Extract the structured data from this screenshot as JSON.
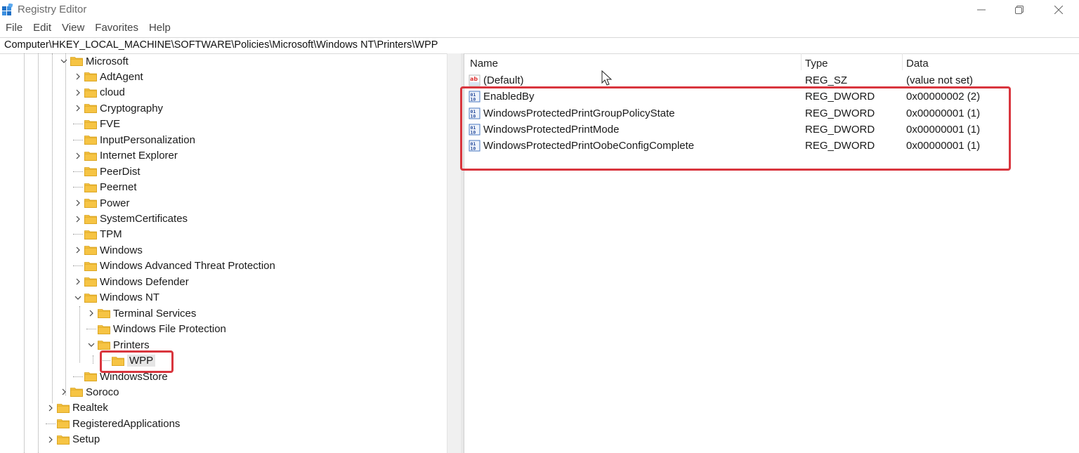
{
  "window": {
    "title": "Registry Editor"
  },
  "menu": {
    "items": [
      "File",
      "Edit",
      "View",
      "Favorites",
      "Help"
    ]
  },
  "address": "Computer\\HKEY_LOCAL_MACHINE\\SOFTWARE\\Policies\\Microsoft\\Windows NT\\Printers\\WPP",
  "tree": [
    {
      "label": "Microsoft",
      "depth": 0,
      "chevron": "down"
    },
    {
      "label": "AdtAgent",
      "depth": 1,
      "chevron": "right"
    },
    {
      "label": "cloud",
      "depth": 1,
      "chevron": "right"
    },
    {
      "label": "Cryptography",
      "depth": 1,
      "chevron": "right"
    },
    {
      "label": "FVE",
      "depth": 1,
      "chevron": "none"
    },
    {
      "label": "InputPersonalization",
      "depth": 1,
      "chevron": "none"
    },
    {
      "label": "Internet Explorer",
      "depth": 1,
      "chevron": "right"
    },
    {
      "label": "PeerDist",
      "depth": 1,
      "chevron": "none"
    },
    {
      "label": "Peernet",
      "depth": 1,
      "chevron": "none"
    },
    {
      "label": "Power",
      "depth": 1,
      "chevron": "right"
    },
    {
      "label": "SystemCertificates",
      "depth": 1,
      "chevron": "right"
    },
    {
      "label": "TPM",
      "depth": 1,
      "chevron": "none"
    },
    {
      "label": "Windows",
      "depth": 1,
      "chevron": "right"
    },
    {
      "label": "Windows Advanced Threat Protection",
      "depth": 1,
      "chevron": "none"
    },
    {
      "label": "Windows Defender",
      "depth": 1,
      "chevron": "right"
    },
    {
      "label": "Windows NT",
      "depth": 1,
      "chevron": "down"
    },
    {
      "label": "Terminal Services",
      "depth": 2,
      "chevron": "right"
    },
    {
      "label": "Windows File Protection",
      "depth": 2,
      "chevron": "none"
    },
    {
      "label": "Printers",
      "depth": 2,
      "chevron": "down"
    },
    {
      "label": "WPP",
      "depth": 3,
      "chevron": "none",
      "selected": true
    },
    {
      "label": "WindowsStore",
      "depth": 1,
      "chevron": "none"
    },
    {
      "label": "Soroco",
      "depth": 0,
      "chevron": "right"
    },
    {
      "label": "Realtek",
      "depth": -1,
      "chevron": "right"
    },
    {
      "label": "RegisteredApplications",
      "depth": -1,
      "chevron": "none"
    },
    {
      "label": "Setup",
      "depth": -1,
      "chevron": "right"
    }
  ],
  "list": {
    "headers": {
      "name": "Name",
      "type": "Type",
      "data": "Data"
    },
    "rows": [
      {
        "icon": "string-value-icon",
        "name": "(Default)",
        "type": "REG_SZ",
        "data": "(value not set)"
      },
      {
        "icon": "dword-value-icon",
        "name": "EnabledBy",
        "type": "REG_DWORD",
        "data": "0x00000002 (2)"
      },
      {
        "icon": "dword-value-icon",
        "name": "WindowsProtectedPrintGroupPolicyState",
        "type": "REG_DWORD",
        "data": "0x00000001 (1)"
      },
      {
        "icon": "dword-value-icon",
        "name": "WindowsProtectedPrintMode",
        "type": "REG_DWORD",
        "data": "0x00000001 (1)"
      },
      {
        "icon": "dword-value-icon",
        "name": "WindowsProtectedPrintOobeConfigComplete",
        "type": "REG_DWORD",
        "data": "0x00000001 (1)"
      }
    ]
  },
  "colors": {
    "highlight": "#d9363e",
    "folder": "#f6c444",
    "selection": "#e5e5e5"
  }
}
